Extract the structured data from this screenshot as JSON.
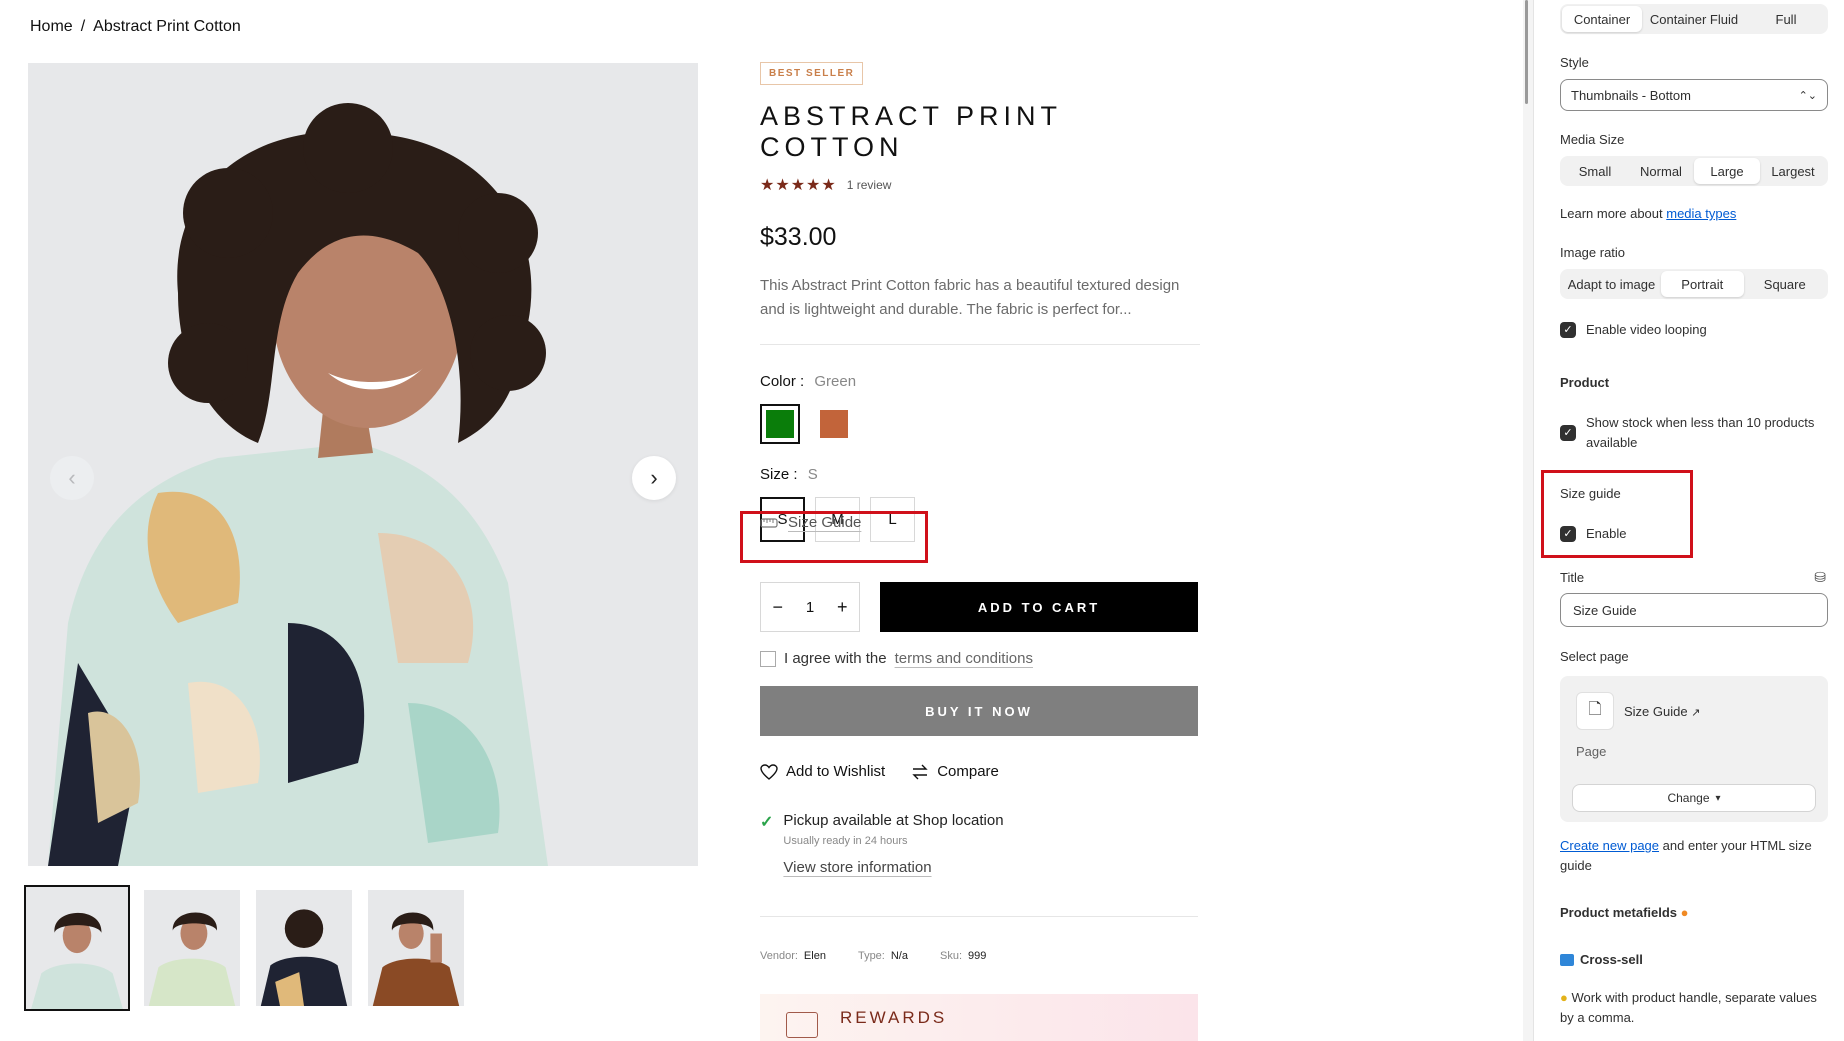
{
  "breadcrumb": {
    "home": "Home",
    "separator": "/",
    "current": "Abstract Print Cotton"
  },
  "gallery": {
    "prev_icon": "chevron-left-icon",
    "next_icon": "chevron-right-icon",
    "thumbnail_count": 4,
    "active_thumbnail": 1
  },
  "product": {
    "badge": "BEST SELLER",
    "title": "ABSTRACT PRINT COTTON",
    "stars": "★★★★★",
    "rating": 5,
    "review_count": "1 review",
    "price": "$33.00",
    "description": "This Abstract Print Cotton fabric has a beautiful textured design and is lightweight and durable. The fabric is perfect for...",
    "color_label": "Color :",
    "color_value": "Green",
    "colors": [
      "#0a7d0a",
      "#c2643a"
    ],
    "size_label": "Size :",
    "size_value": "S",
    "sizes": [
      "S",
      "M",
      "L"
    ],
    "size_guide": "Size Guide",
    "quantity": "1",
    "qty_minus": "−",
    "qty_plus": "+",
    "add_to_cart": "ADD TO CART",
    "terms_prefix": "I agree with the",
    "terms_link": "terms and conditions",
    "buy_now": "BUY IT NOW",
    "wishlist": "Add to Wishlist",
    "compare": "Compare",
    "pickup_main": "Pickup available at Shop location",
    "pickup_sub": "Usually ready in 24 hours",
    "store_link": "View store information",
    "vendor_label": "Vendor:",
    "vendor": "Elen",
    "type_label": "Type:",
    "type": "N/a",
    "sku_label": "Sku:",
    "sku": "999",
    "rewards": "REWARDS"
  },
  "panel": {
    "width_options": [
      "Container",
      "Container Fluid",
      "Full"
    ],
    "width_selected": "Container",
    "style_label": "Style",
    "style_value": "Thumbnails - Bottom",
    "media_size_label": "Media Size",
    "media_sizes": [
      "Small",
      "Normal",
      "Large",
      "Largest"
    ],
    "media_size_selected": "Large",
    "learn_prefix": "Learn more about",
    "learn_link": "media types",
    "image_ratio_label": "Image ratio",
    "ratios": [
      "Adapt to image",
      "Portrait",
      "Square"
    ],
    "ratio_selected": "Portrait",
    "video_looping": "Enable video looping",
    "product_heading": "Product",
    "show_stock": "Show stock when less than 10 products available",
    "size_guide_heading": "Size guide",
    "enable": "Enable",
    "title_label": "Title",
    "title_value": "Size Guide",
    "select_page_label": "Select page",
    "page_name": "Size Guide",
    "page_kind": "Page",
    "change": "Change",
    "create_link": "Create new page",
    "create_suffix": "and enter your HTML size guide",
    "metafields_heading": "Product metafields",
    "cross_sell": "Cross-sell",
    "cross_sell_note": "Work with product handle, separate values by a comma.",
    "accent": "#005bd3"
  }
}
